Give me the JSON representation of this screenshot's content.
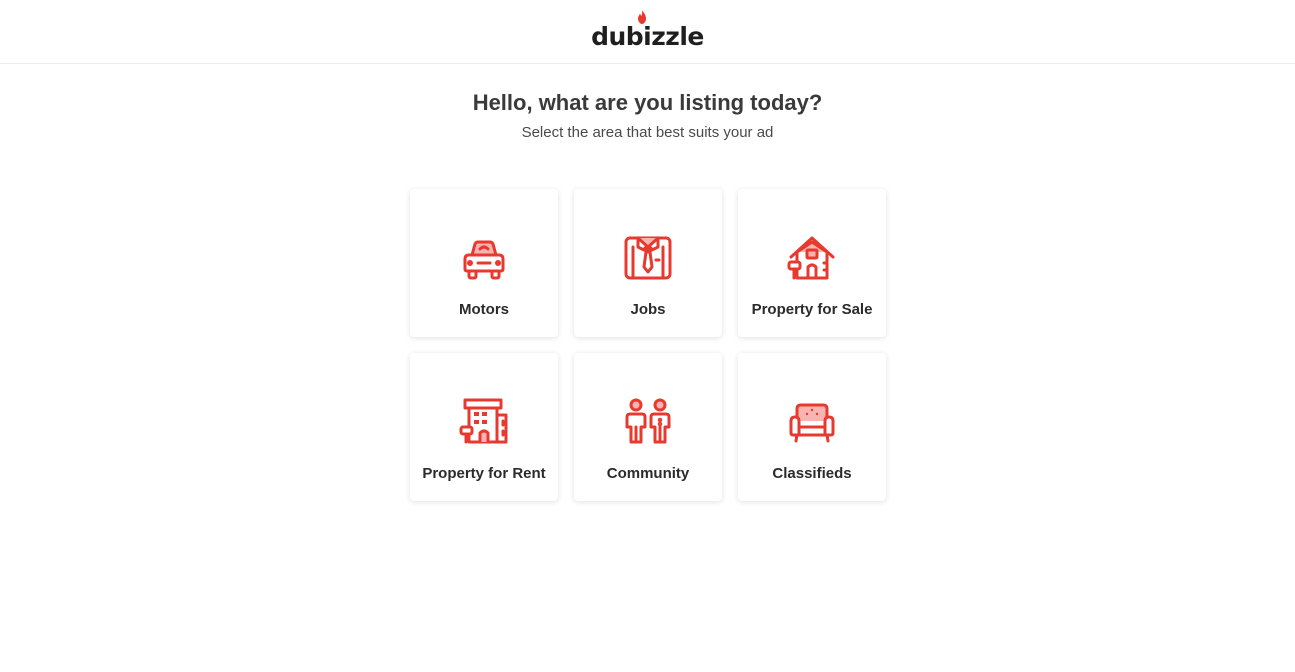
{
  "brand": {
    "name": "dubizzle",
    "accent": "#e8392f",
    "accent_light": "#f6b5b0"
  },
  "intro": {
    "heading": "Hello, what are you listing today?",
    "subheading": "Select the area that best suits your ad"
  },
  "categories": [
    {
      "label": "Motors",
      "icon": "car-icon"
    },
    {
      "label": "Jobs",
      "icon": "shirt-tie-icon"
    },
    {
      "label": "Property for Sale",
      "icon": "house-sale-icon"
    },
    {
      "label": "Property for Rent",
      "icon": "building-rent-icon"
    },
    {
      "label": "Community",
      "icon": "people-icon"
    },
    {
      "label": "Classifieds",
      "icon": "sofa-icon"
    }
  ]
}
